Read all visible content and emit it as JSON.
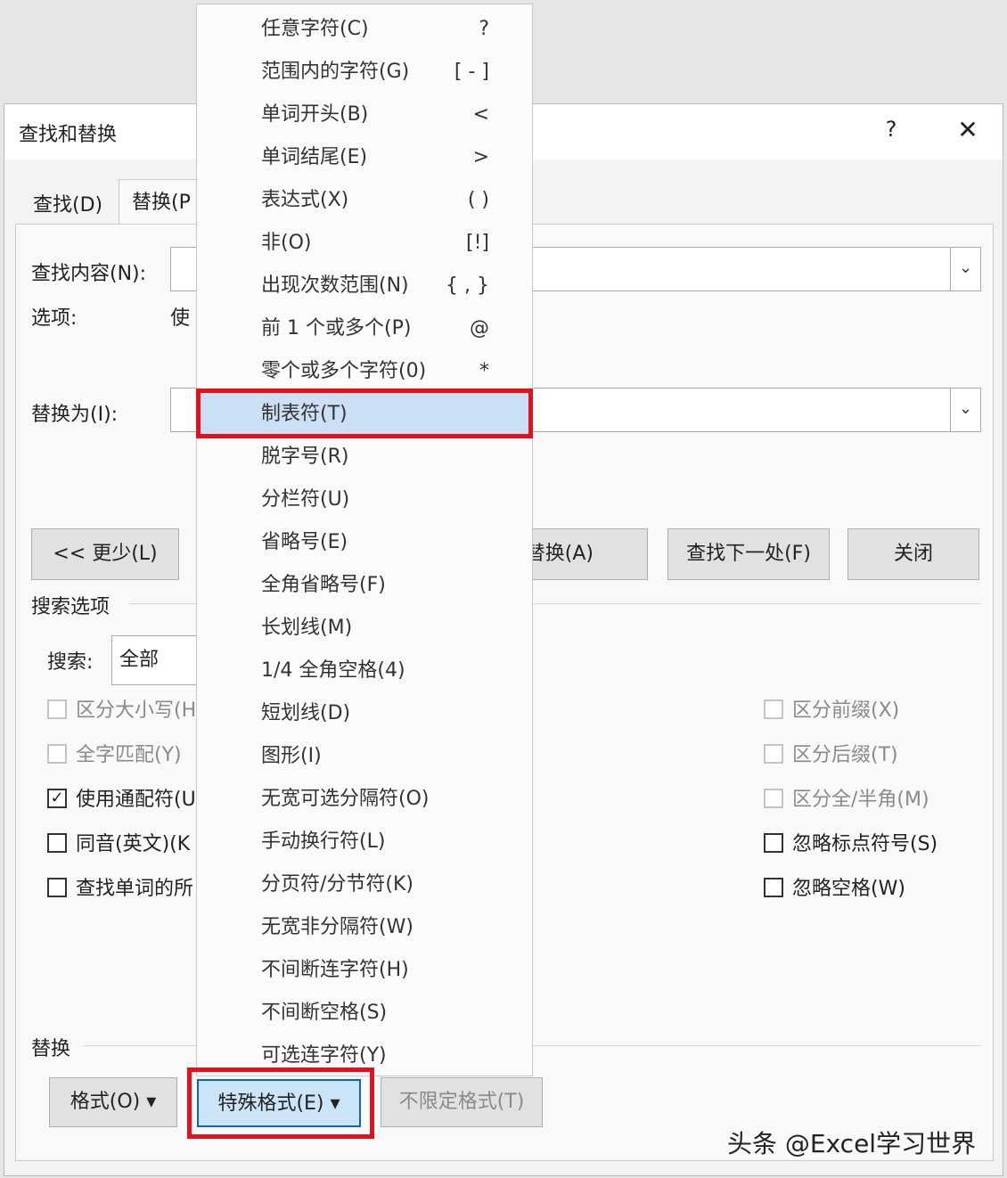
{
  "dialog": {
    "title": "查找和替换",
    "help": "?",
    "close": "✕",
    "tabs": [
      "查找(D)",
      "替换(P"
    ]
  },
  "form": {
    "find_label": "查找内容(N):",
    "options_label": "选项:",
    "options_value": "使",
    "replace_label": "替换为(I):",
    "dropdown_icon": "chevron-down"
  },
  "buttons": {
    "less": "<< 更少(L)",
    "replace_all": "替换(A)",
    "find_next": "查找下一处(F)",
    "close": "关闭"
  },
  "search_options": {
    "heading": "搜索选项",
    "search_label": "搜索:",
    "search_value": "全部",
    "left": [
      {
        "label": "区分大小写(H",
        "checked": false,
        "disabled": true
      },
      {
        "label": "全字匹配(Y)",
        "checked": false,
        "disabled": true
      },
      {
        "label": "使用通配符(U",
        "checked": true,
        "disabled": false
      },
      {
        "label": "同音(英文)(K",
        "checked": false,
        "disabled": false
      },
      {
        "label": "查找单词的所",
        "checked": false,
        "disabled": false
      }
    ],
    "right": [
      {
        "label": "区分前缀(X)",
        "checked": false,
        "disabled": true
      },
      {
        "label": "区分后缀(T)",
        "checked": false,
        "disabled": true
      },
      {
        "label": "区分全/半角(M)",
        "checked": false,
        "disabled": true
      },
      {
        "label": "忽略标点符号(S)",
        "checked": false,
        "disabled": false
      },
      {
        "label": "忽略空格(W)",
        "checked": false,
        "disabled": false
      }
    ]
  },
  "replace_section": {
    "heading": "替换",
    "format_btn": "格式(O) ▾",
    "special_btn": "特殊格式(E) ▾",
    "no_format_btn": "不限定格式(T)"
  },
  "menu": {
    "items": [
      {
        "label": "任意字符(C)",
        "symbol": "?"
      },
      {
        "label": "范围内的字符(G)",
        "symbol": "[ - ]"
      },
      {
        "label": "单词开头(B)",
        "symbol": "<"
      },
      {
        "label": "单词结尾(E)",
        "symbol": ">"
      },
      {
        "label": "表达式(X)",
        "symbol": "( )"
      },
      {
        "label": "非(O)",
        "symbol": "[!]"
      },
      {
        "label": "出现次数范围(N)",
        "symbol": "{ , }"
      },
      {
        "label": "前 1 个或多个(P)",
        "symbol": "@"
      },
      {
        "label": "零个或多个字符(0)",
        "symbol": "*"
      },
      {
        "label": "制表符(T)",
        "symbol": ""
      },
      {
        "label": "脱字号(R)",
        "symbol": ""
      },
      {
        "label": "分栏符(U)",
        "symbol": ""
      },
      {
        "label": "省略号(E)",
        "symbol": ""
      },
      {
        "label": "全角省略号(F)",
        "symbol": ""
      },
      {
        "label": "长划线(M)",
        "symbol": ""
      },
      {
        "label": "1/4 全角空格(4)",
        "symbol": ""
      },
      {
        "label": "短划线(D)",
        "symbol": ""
      },
      {
        "label": "图形(I)",
        "symbol": ""
      },
      {
        "label": "无宽可选分隔符(O)",
        "symbol": ""
      },
      {
        "label": "手动换行符(L)",
        "symbol": ""
      },
      {
        "label": "分页符/分节符(K)",
        "symbol": ""
      },
      {
        "label": "无宽非分隔符(W)",
        "symbol": ""
      },
      {
        "label": "不间断连字符(H)",
        "symbol": ""
      },
      {
        "label": "不间断空格(S)",
        "symbol": ""
      },
      {
        "label": "可选连字符(Y)",
        "symbol": ""
      }
    ]
  },
  "watermark": "头条 @Excel学习世界",
  "colors": {
    "highlight_box": "#e3101d",
    "menu_highlight": "#cce0f5"
  }
}
